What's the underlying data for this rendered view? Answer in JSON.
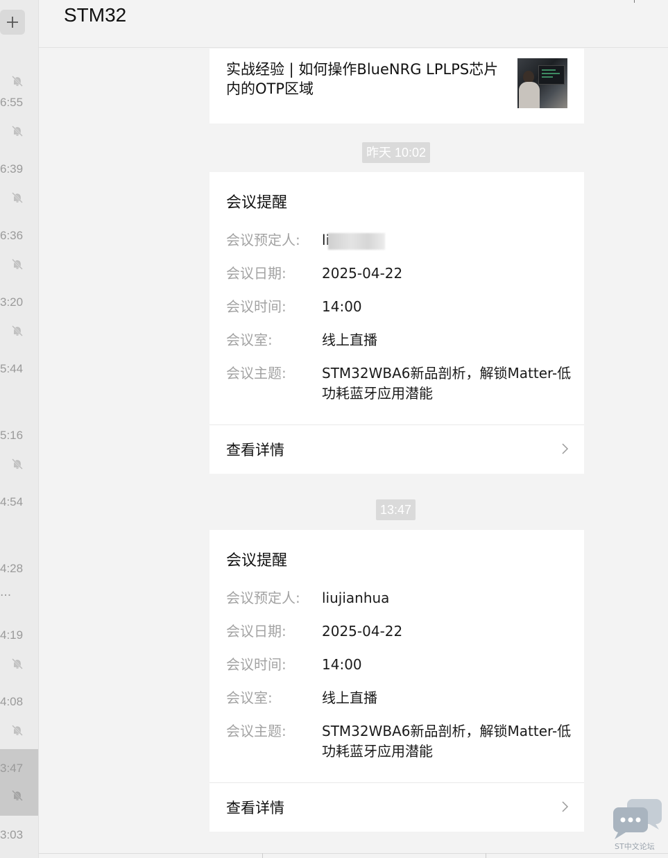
{
  "header": {
    "title": "STM32"
  },
  "sidebar": {
    "items": [
      {
        "time": "",
        "muted": true
      },
      {
        "time": "6:55",
        "muted": true
      },
      {
        "time": "6:39",
        "muted": true
      },
      {
        "time": "6:36",
        "muted": true
      },
      {
        "time": "3:20",
        "muted": true
      },
      {
        "time": "5:44",
        "muted": false
      },
      {
        "time": "5:16",
        "muted": true
      },
      {
        "time": "4:54",
        "muted": false
      },
      {
        "time": "4:28",
        "muted": false,
        "ellipsis": "..."
      },
      {
        "time": "4:19",
        "muted": true
      },
      {
        "time": "4:08",
        "muted": true
      },
      {
        "time": "3:47",
        "muted": true
      },
      {
        "time": "3:03",
        "muted": false
      }
    ]
  },
  "article": {
    "title": "实战经验 | 如何操作BlueNRG LPLPS芯片内的OTP区域"
  },
  "stamps": {
    "first": "昨天 10:02",
    "second": "13:47"
  },
  "meetings": [
    {
      "heading": "会议提醒",
      "organizer_label": "会议预定人:",
      "organizer_value": "li",
      "date_label": "会议日期:",
      "date_value": "2025-04-22",
      "time_label": "会议时间:",
      "time_value": "14:00",
      "room_label": "会议室:",
      "room_value": "线上直播",
      "topic_label": "会议主题:",
      "topic_value": "STM32WBA6新品剖析，解锁Matter-低功耗蓝牙应用潜能",
      "detail_label": "查看详情"
    },
    {
      "heading": "会议提醒",
      "organizer_label": "会议预定人:",
      "organizer_value": "liujianhua",
      "date_label": "会议日期:",
      "date_value": "2025-04-22",
      "time_label": "会议时间:",
      "time_value": "14:00",
      "room_label": "会议室:",
      "room_value": "线上直播",
      "topic_label": "会议主题:",
      "topic_value": "STM32WBA6新品剖析，解锁Matter-低功耗蓝牙应用潜能",
      "detail_label": "查看详情"
    }
  ],
  "watermark": {
    "text": "ST中文论坛"
  }
}
